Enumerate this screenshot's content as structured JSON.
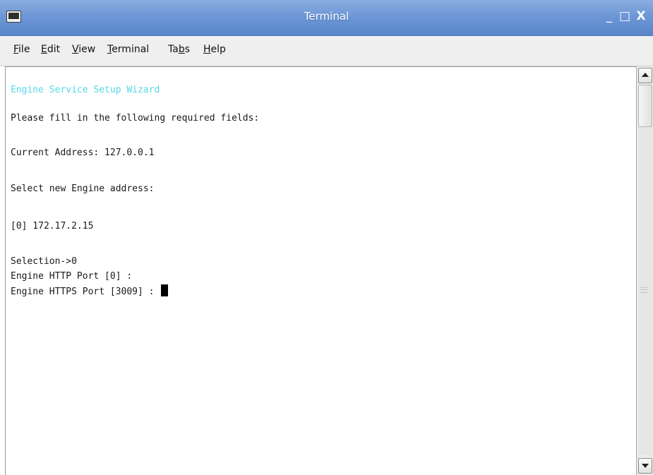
{
  "window": {
    "title": "Terminal",
    "minimize_glyph": "_",
    "maximize_glyph": "□",
    "close_glyph": "X",
    "icon": "terminal-icon"
  },
  "menubar": {
    "items": [
      {
        "pre": "",
        "key": "F",
        "post": "ile"
      },
      {
        "pre": "",
        "key": "E",
        "post": "dit"
      },
      {
        "pre": "",
        "key": "V",
        "post": "iew"
      },
      {
        "pre": "",
        "key": "T",
        "post": "erminal"
      },
      {
        "pre": "Ta",
        "key": "b",
        "post": "s"
      },
      {
        "pre": "",
        "key": "H",
        "post": "elp"
      }
    ]
  },
  "terminal": {
    "heading_color": "#55d8e8",
    "lines": [
      "Engine Service Setup Wizard",
      "Please fill in the following required fields:",
      "Current Address: 127.0.0.1",
      "Select new Engine address:",
      "[0] 172.17.2.15",
      "Selection->0",
      "Engine HTTP Port [0] :",
      "Engine HTTPS Port [3009] :"
    ]
  },
  "scrollbar": {
    "up_icon": "arrow-up-icon",
    "down_icon": "arrow-down-icon"
  }
}
